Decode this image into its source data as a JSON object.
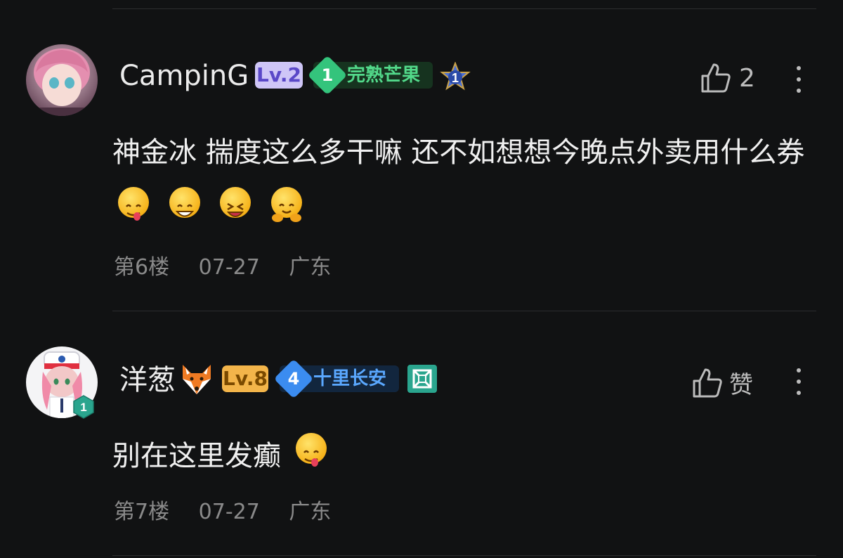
{
  "comments": [
    {
      "username": "CampinG",
      "level": "Lv.2",
      "fan_badge": {
        "number": "1",
        "name": "完熟芒果"
      },
      "extra_badge": "1",
      "like_count": "2",
      "text": "神金冰 揣度这么多干嘛 还不如想想今晚点外卖用什么券",
      "emojis": [
        "yum-face",
        "grin-face",
        "laugh-squint-face",
        "hug-face"
      ],
      "floor": "第6楼",
      "date": "07-27",
      "location": "广东",
      "colors": {
        "level_bg": "#cfc6f7",
        "level_fg": "#5a48c8",
        "fan_diamond": "#34c47c",
        "fan_bg": "#16331f",
        "fan_fg": "#52d98a"
      }
    },
    {
      "username": "洋葱",
      "username_icon": "fox-icon",
      "level": "Lv.8",
      "avatar_badge": "1",
      "fan_badge": {
        "number": "4",
        "name": "十里长安"
      },
      "like_label": "赞",
      "text": "别在这里发癫",
      "emojis": [
        "yum-face"
      ],
      "floor": "第7楼",
      "date": "07-27",
      "location": "广东",
      "colors": {
        "level_bg": "#f3b54a",
        "level_fg": "#7a4a00",
        "fan_diamond": "#3b8cf0",
        "fan_bg": "#12263e",
        "fan_fg": "#5aa8ff",
        "extra_badge": "#2aa58e"
      }
    }
  ]
}
